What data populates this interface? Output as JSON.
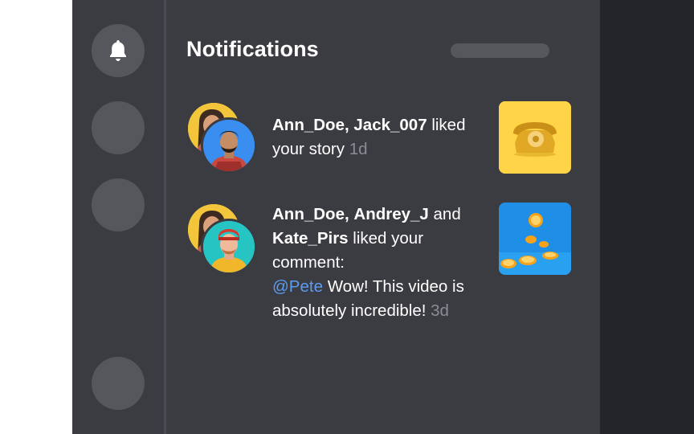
{
  "header": {
    "title": "Notifications"
  },
  "notifications": [
    {
      "user1": "Ann_Doe,",
      "user2": "Jack_007",
      "action": "liked your story",
      "time": "1d"
    },
    {
      "user1": "Ann_Doe,",
      "user2": "Andrey_J",
      "joiner": "and",
      "user3": "Kate_Pirs",
      "action": "liked your comment:",
      "mention": "@Pete",
      "comment": "Wow! This video is absolutely incredible!",
      "time": "3d"
    }
  ],
  "icons": [
    "bell-icon",
    "telephone-thumbnail",
    "oranges-thumbnail"
  ],
  "colors": {
    "panel": "#3b3b42",
    "rail_button": "#56565d",
    "right_bg": "#24242b",
    "mention": "#5b9cf2",
    "muted": "#8c8c94",
    "phone_bg": "#ffd447",
    "oranges_bg": "#1e8ee6"
  }
}
